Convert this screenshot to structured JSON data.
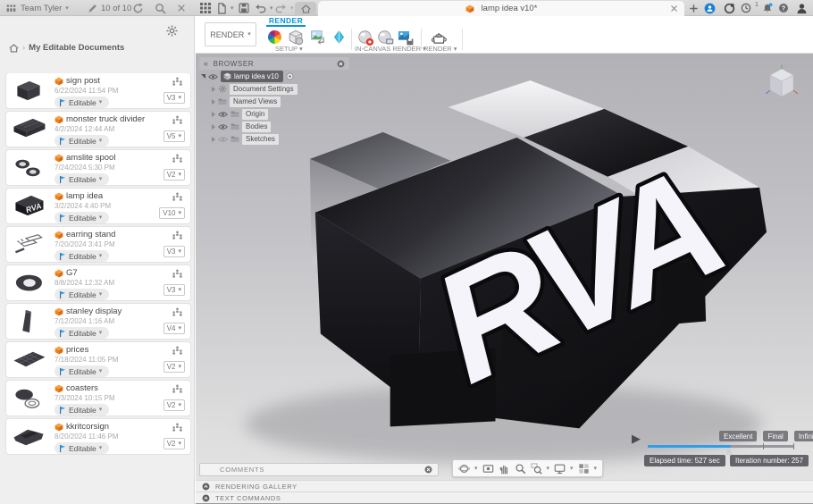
{
  "app": {
    "team_label": "Team Tyler",
    "doc_counter": "10 of 10",
    "active_tab": "lamp idea v10*",
    "notification_count": "1"
  },
  "ribbon": {
    "workspace_button": "RENDER",
    "active_tab_label": "RENDER",
    "groups": [
      {
        "label": "SETUP"
      },
      {
        "label": "IN-CANVAS RENDER"
      },
      {
        "label": "RENDER"
      }
    ]
  },
  "sidebar": {
    "breadcrumb": "My Editable Documents",
    "documents": [
      {
        "name": "sign post",
        "date": "6/22/2024 11:54 PM",
        "status": "Editable",
        "version": "V3",
        "thumb": "box"
      },
      {
        "name": "monster truck divider",
        "date": "4/2/2024 12:44 AM",
        "status": "Editable",
        "version": "V5",
        "thumb": "tray"
      },
      {
        "name": "amslite spool",
        "date": "7/24/2024 5:30 PM",
        "status": "Editable",
        "version": "V2",
        "thumb": "spools"
      },
      {
        "name": "lamp idea",
        "date": "3/2/2024 4:40 PM",
        "status": "Editable",
        "version": "V10",
        "thumb": "rva"
      },
      {
        "name": "earring stand",
        "date": "7/20/2024 3:41 PM",
        "status": "Editable",
        "version": "V3",
        "thumb": "stand"
      },
      {
        "name": "G7",
        "date": "8/8/2024 12:32 AM",
        "status": "Editable",
        "version": "V3",
        "thumb": "disc"
      },
      {
        "name": "stanley display",
        "date": "7/12/2024 1:16 AM",
        "status": "Editable",
        "version": "V4",
        "thumb": "tower"
      },
      {
        "name": "prices",
        "date": "7/18/2024 11:05 PM",
        "status": "Editable",
        "version": "V2",
        "thumb": "grid"
      },
      {
        "name": "coasters",
        "date": "7/3/2024 10:15 PM",
        "status": "Editable",
        "version": "V2",
        "thumb": "discs"
      },
      {
        "name": "kkritcorsign",
        "date": "8/20/2024 11:46 PM",
        "status": "Editable",
        "version": "V2",
        "thumb": "wedge"
      }
    ]
  },
  "browser": {
    "title": "BROWSER",
    "root_label": "lamp idea v10",
    "items": [
      {
        "label": "Document Settings",
        "icon": "gear",
        "eye": "none"
      },
      {
        "label": "Named Views",
        "icon": "folder",
        "eye": "none"
      },
      {
        "label": "Origin",
        "icon": "folder",
        "eye": "on"
      },
      {
        "label": "Bodies",
        "icon": "folder",
        "eye": "on"
      },
      {
        "label": "Sketches",
        "icon": "folder",
        "eye": "dim"
      }
    ]
  },
  "canvas": {
    "model_text": "RVA",
    "quality_labels": [
      "Excellent",
      "Final",
      "Infinite"
    ],
    "elapsed_badge": "Elapsed time: 527 sec",
    "iteration_badge": "Iteration number: 257",
    "progress_percent": 57
  },
  "panels": {
    "comments_label": "COMMENTS",
    "rendering_gallery_label": "RENDERING GALLERY",
    "text_commands_label": "TEXT COMMANDS"
  },
  "colors": {
    "accent_blue": "#0696d7",
    "progress_blue": "#2f9fe5",
    "doc_icon_orange": "#f6871f"
  }
}
